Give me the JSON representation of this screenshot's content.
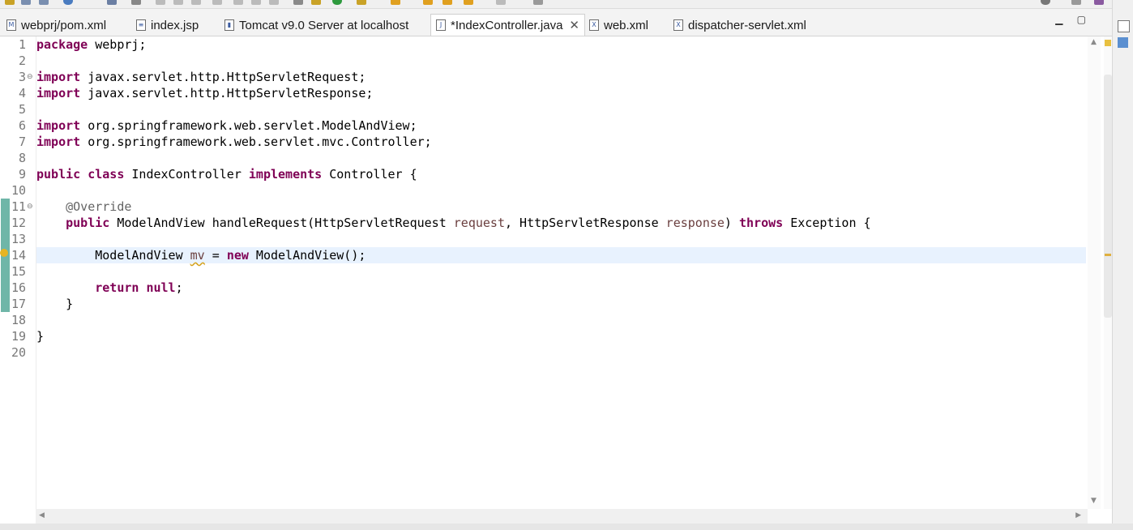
{
  "tabs": [
    {
      "label": "webprj/pom.xml",
      "icon": "maven-file-icon",
      "glyph": "M"
    },
    {
      "label": "index.jsp",
      "icon": "jsp-file-icon",
      "glyph": "≡"
    },
    {
      "label": "Tomcat v9.0 Server at localhost",
      "icon": "server-icon",
      "glyph": "▮"
    },
    {
      "label": "*IndexController.java",
      "icon": "java-file-icon",
      "glyph": "J",
      "active": true
    },
    {
      "label": "web.xml",
      "icon": "xml-file-icon",
      "glyph": "X"
    },
    {
      "label": "dispatcher-servlet.xml",
      "icon": "xml-file-icon",
      "glyph": "X"
    }
  ],
  "window_buttons": {
    "minimize": "▁",
    "maximize": "▢"
  },
  "close_glyph": "✕",
  "code": {
    "line_numbers": [
      "1",
      "2",
      "3",
      "4",
      "5",
      "6",
      "7",
      "8",
      "9",
      "10",
      "11",
      "12",
      "13",
      "14",
      "15",
      "16",
      "17",
      "18",
      "19",
      "20"
    ],
    "current_line": 14,
    "lines": [
      [
        {
          "t": "package",
          "c": "kw"
        },
        {
          "t": " webprj;"
        }
      ],
      [],
      [
        {
          "t": "import",
          "c": "kw"
        },
        {
          "t": " javax.servlet.http.HttpServletRequest;"
        }
      ],
      [
        {
          "t": "import",
          "c": "kw"
        },
        {
          "t": " javax.servlet.http.HttpServletResponse;"
        }
      ],
      [],
      [
        {
          "t": "import",
          "c": "kw"
        },
        {
          "t": " org.springframework.web.servlet.ModelAndView;"
        }
      ],
      [
        {
          "t": "import",
          "c": "kw"
        },
        {
          "t": " org.springframework.web.servlet.mvc.Controller;"
        }
      ],
      [],
      [
        {
          "t": "public",
          "c": "kw"
        },
        {
          "t": " "
        },
        {
          "t": "class",
          "c": "kw"
        },
        {
          "t": " IndexController "
        },
        {
          "t": "implements",
          "c": "kw"
        },
        {
          "t": " Controller {"
        }
      ],
      [],
      [
        {
          "t": "    "
        },
        {
          "t": "@Override",
          "c": "ann"
        }
      ],
      [
        {
          "t": "    "
        },
        {
          "t": "public",
          "c": "kw"
        },
        {
          "t": " ModelAndView handleRequest(HttpServletRequest "
        },
        {
          "t": "request",
          "c": "param"
        },
        {
          "t": ", HttpServletResponse "
        },
        {
          "t": "response",
          "c": "param"
        },
        {
          "t": ") "
        },
        {
          "t": "throws",
          "c": "kw"
        },
        {
          "t": " Exception {"
        }
      ],
      [],
      [
        {
          "t": "        ModelAndView "
        },
        {
          "t": "mv",
          "c": "warn"
        },
        {
          "t": " = "
        },
        {
          "t": "new",
          "c": "kw"
        },
        {
          "t": " ModelAndView();"
        }
      ],
      [],
      [
        {
          "t": "        "
        },
        {
          "t": "return",
          "c": "kw"
        },
        {
          "t": " "
        },
        {
          "t": "null",
          "c": "kw"
        },
        {
          "t": ";"
        }
      ],
      [
        {
          "t": "    }"
        }
      ],
      [],
      [
        {
          "t": "}"
        }
      ],
      []
    ]
  },
  "colors": {
    "keyword": "#7f0055",
    "annotation": "#646464",
    "parameter": "#6a3e3e",
    "current_line": "#e8f2fe",
    "change_bar": "#6fb6a8"
  }
}
